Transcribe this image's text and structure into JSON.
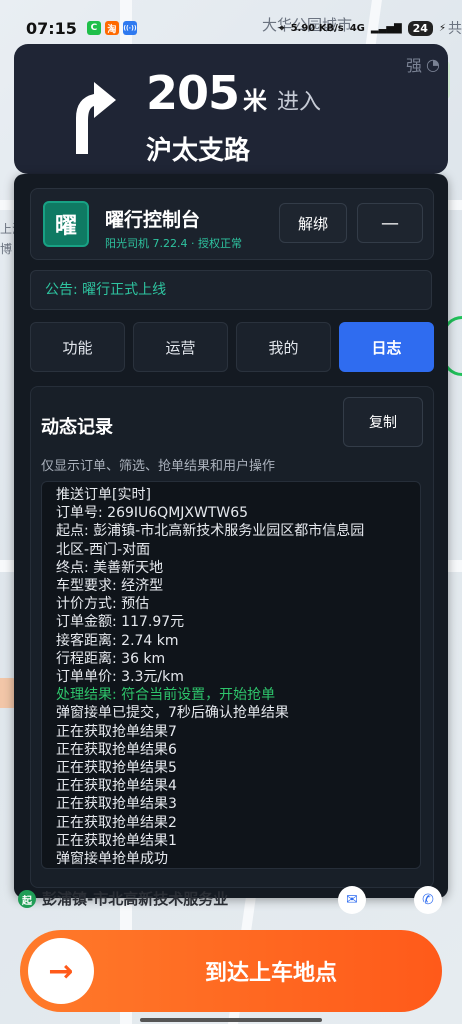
{
  "status_bar": {
    "time": "07:15",
    "apps": [
      {
        "icon": "c-app-icon",
        "label": "C",
        "color": "#1fbf4a"
      },
      {
        "icon": "taobao-icon",
        "label": "淘",
        "color": "#ff6a00"
      },
      {
        "icon": "nfc-icon",
        "label": "((·))",
        "color": "#2f7af0"
      }
    ],
    "network_speed": "5.90 KB/s",
    "signal": "4G",
    "battery": "24"
  },
  "map": {
    "labels": [
      "大华公园城市",
      "共",
      "上海",
      "博"
    ]
  },
  "navigation": {
    "distance": "205",
    "unit": "米",
    "action": "进入",
    "road": "沪太支路",
    "signal_strength": "强"
  },
  "panel": {
    "logo_char": "曜",
    "title": "曜行控制台",
    "subtitle": "阳光司机 7.22.4 · 授权正常",
    "unbind_label": "解绑",
    "minimize_label": "—",
    "notice": "公告: 曜行正式上线",
    "tabs": [
      {
        "label": "功能",
        "active": false
      },
      {
        "label": "运营",
        "active": false
      },
      {
        "label": "我的",
        "active": false
      },
      {
        "label": "日志",
        "active": true
      }
    ],
    "log": {
      "title": "动态记录",
      "copy_label": "复制",
      "hint": "仅显示订单、筛选、抢单结果和用户操作",
      "lines": [
        {
          "text": "推送订单[实时]",
          "status": "normal"
        },
        {
          "text": "订单号: 269IU6QMJXWTW65",
          "status": "normal"
        },
        {
          "text": "起点: 彭浦镇-市北高新技术服务业园区都市信息园",
          "status": "normal"
        },
        {
          "text": "北区-西门-对面",
          "status": "normal"
        },
        {
          "text": "终点: 美善新天地",
          "status": "normal"
        },
        {
          "text": "车型要求: 经济型",
          "status": "normal"
        },
        {
          "text": "计价方式: 预估",
          "status": "normal"
        },
        {
          "text": "订单金额: 117.97元",
          "status": "normal"
        },
        {
          "text": "接客距离: 2.74 km",
          "status": "normal"
        },
        {
          "text": "行程距离: 36 km",
          "status": "normal"
        },
        {
          "text": "订单单价: 3.3元/km",
          "status": "normal"
        },
        {
          "text": "处理结果: 符合当前设置，开始抢单",
          "status": "ok"
        },
        {
          "text": "弹窗接单已提交，7秒后确认抢单结果",
          "status": "normal"
        },
        {
          "text": "正在获取抢单结果7",
          "status": "normal"
        },
        {
          "text": "正在获取抢单结果6",
          "status": "normal"
        },
        {
          "text": "正在获取抢单结果5",
          "status": "normal"
        },
        {
          "text": "正在获取抢单结果4",
          "status": "normal"
        },
        {
          "text": "正在获取抢单结果3",
          "status": "normal"
        },
        {
          "text": "正在获取抢单结果2",
          "status": "normal"
        },
        {
          "text": "正在获取抢单结果1",
          "status": "normal"
        },
        {
          "text": "弹窗接单抢单成功",
          "status": "normal"
        }
      ]
    }
  },
  "destination": {
    "badge": "起",
    "address": "彭浦镇-市北高新技术服务业"
  },
  "arrive_button": {
    "label": "到达上车地点",
    "icon": "arrow-right-icon"
  },
  "colors": {
    "accent_blue": "#2f6cf0",
    "accent_green": "#2ec4a0",
    "success_green": "#2ec46b",
    "orange": "#ff5a1a",
    "nav_bg": "#1f2535",
    "panel_bg": "#141a22"
  }
}
